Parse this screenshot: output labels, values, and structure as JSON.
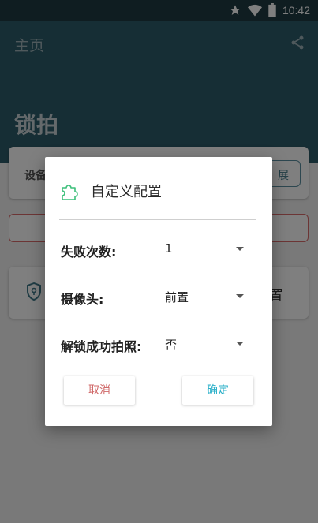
{
  "status_bar": {
    "time": "10:42",
    "icons": [
      "star-icon",
      "wifi-icon",
      "battery-icon"
    ]
  },
  "header": {
    "nav_title": "主页",
    "page_title": "锁拍",
    "share_icon": "share-icon"
  },
  "background": {
    "device_card_label": "设备",
    "device_button_label": "展",
    "config_card_icon": "shield-icon",
    "config_card_label": "置"
  },
  "dialog": {
    "icon": "puzzle-icon",
    "title": "自定义配置",
    "rows": [
      {
        "label": "失败次数:",
        "value": "1"
      },
      {
        "label": "摄像头:",
        "value": "前置"
      },
      {
        "label": "解锁成功拍照:",
        "value": "否"
      }
    ],
    "cancel_label": "取消",
    "ok_label": "确定"
  },
  "colors": {
    "header": "#2d5c6a",
    "status_bar": "#1f3a43",
    "accent": "#2bb0c9",
    "cancel": "#d06a6a",
    "icon_green": "#3cbf7a"
  }
}
